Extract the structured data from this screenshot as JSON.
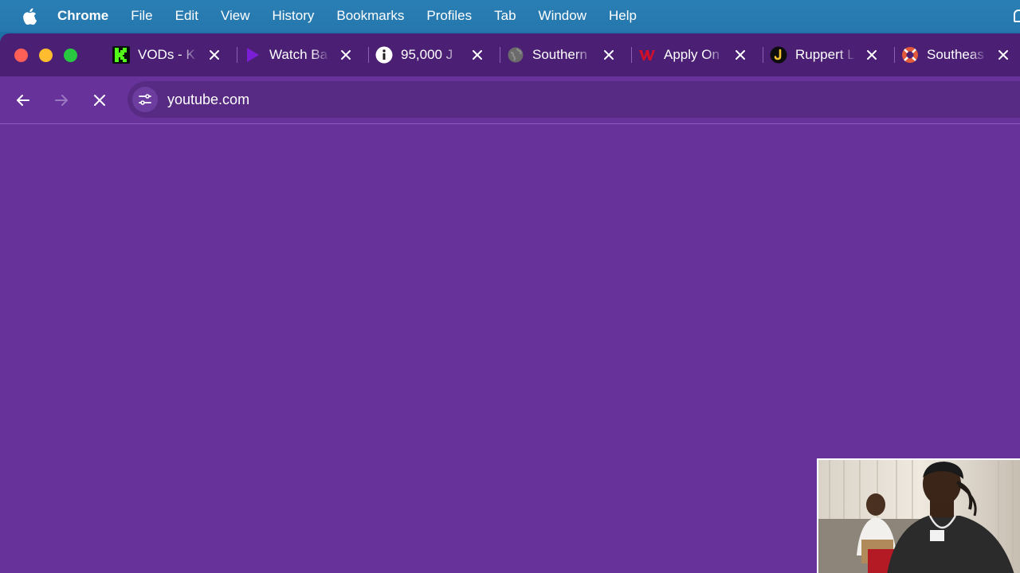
{
  "menubar": {
    "apple_icon": "apple-logo-icon",
    "items": [
      "Chrome",
      "File",
      "Edit",
      "View",
      "History",
      "Bookmarks",
      "Profiles",
      "Tab",
      "Window",
      "Help"
    ]
  },
  "window": {
    "tabs": [
      {
        "title": "VODs - K",
        "favicon": "kick-k-icon",
        "favicon_color": "#53fc18"
      },
      {
        "title": "Watch Ba",
        "favicon": "play-triangle-icon",
        "favicon_color": "#7b1fd6"
      },
      {
        "title": "95,000 J",
        "favicon": "info-icon",
        "favicon_color": "#ffffff"
      },
      {
        "title": "Southern",
        "favicon": "globe-icon",
        "favicon_color": "#8c8c8c"
      },
      {
        "title": "Apply On",
        "favicon": "red-w-logo-icon",
        "favicon_color": "#d0102b"
      },
      {
        "title": "Ruppert L",
        "favicon": "j-letter-icon",
        "favicon_color": "#f4c430"
      },
      {
        "title": "Southeas",
        "favicon": "lifebuoy-icon",
        "favicon_color": "#e05a3a"
      }
    ],
    "toolbar": {
      "url": "youtube.com"
    }
  },
  "colors": {
    "page_background": "#67339a",
    "tabstrip": "#4a1f74",
    "omnibox": "#572b83",
    "menubar": "#2577ad"
  }
}
